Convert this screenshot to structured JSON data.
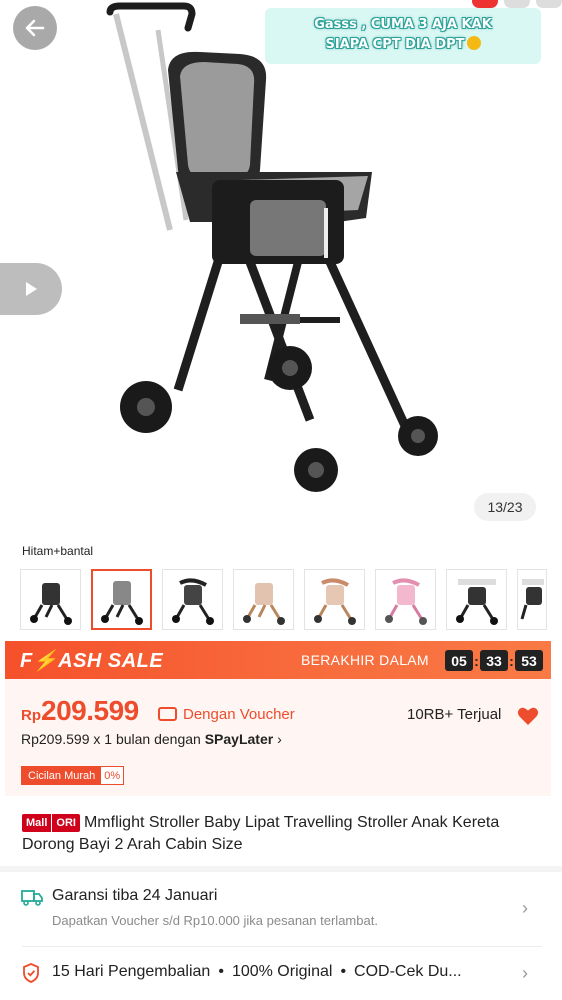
{
  "overlay": {
    "caption_line1": "Gasss , CUMA 3 AJA KAK",
    "caption_line2": "SIAPA CPT DIA DPT",
    "image_counter": "13/23"
  },
  "variant": {
    "selected_label": "Hitam+bantal",
    "thumb_count": 8,
    "selected_index": 1
  },
  "flash_sale": {
    "title": "F⚡ASH SALE",
    "ends_label": "BERAKHIR DALAM",
    "hours": "05",
    "minutes": "33",
    "seconds": "53"
  },
  "price": {
    "currency": "Rp",
    "amount": "209.599",
    "voucher_text": "Dengan Voucher",
    "sold": "10RB+ Terjual",
    "installment_prefix": "Rp209.599 x 1 bulan dengan ",
    "installment_brand": "SPayLater",
    "installment_chevron": "›",
    "cicilan_label": "Cicilan Murah",
    "cicilan_pct": "0%"
  },
  "product": {
    "badge_mall": "Mall",
    "badge_ori": "ORI",
    "title": "Mmflight Stroller Baby Lipat Travelling Stroller Anak Kereta Dorong Bayi 2 Arah Cabin Size"
  },
  "shipping": {
    "title": "Garansi tiba 24 Januari",
    "subtitle": "Dapatkan Voucher s/d Rp10.000 jika pesanan terlambat."
  },
  "guarantee": {
    "item1": "15 Hari Pengembalian",
    "item2": "100% Original",
    "item3": "COD-Cek Du..."
  },
  "colors": {
    "brand": "#ee4d2d",
    "flash_start": "#f5512b",
    "caption_bg": "#d9f7f3"
  }
}
